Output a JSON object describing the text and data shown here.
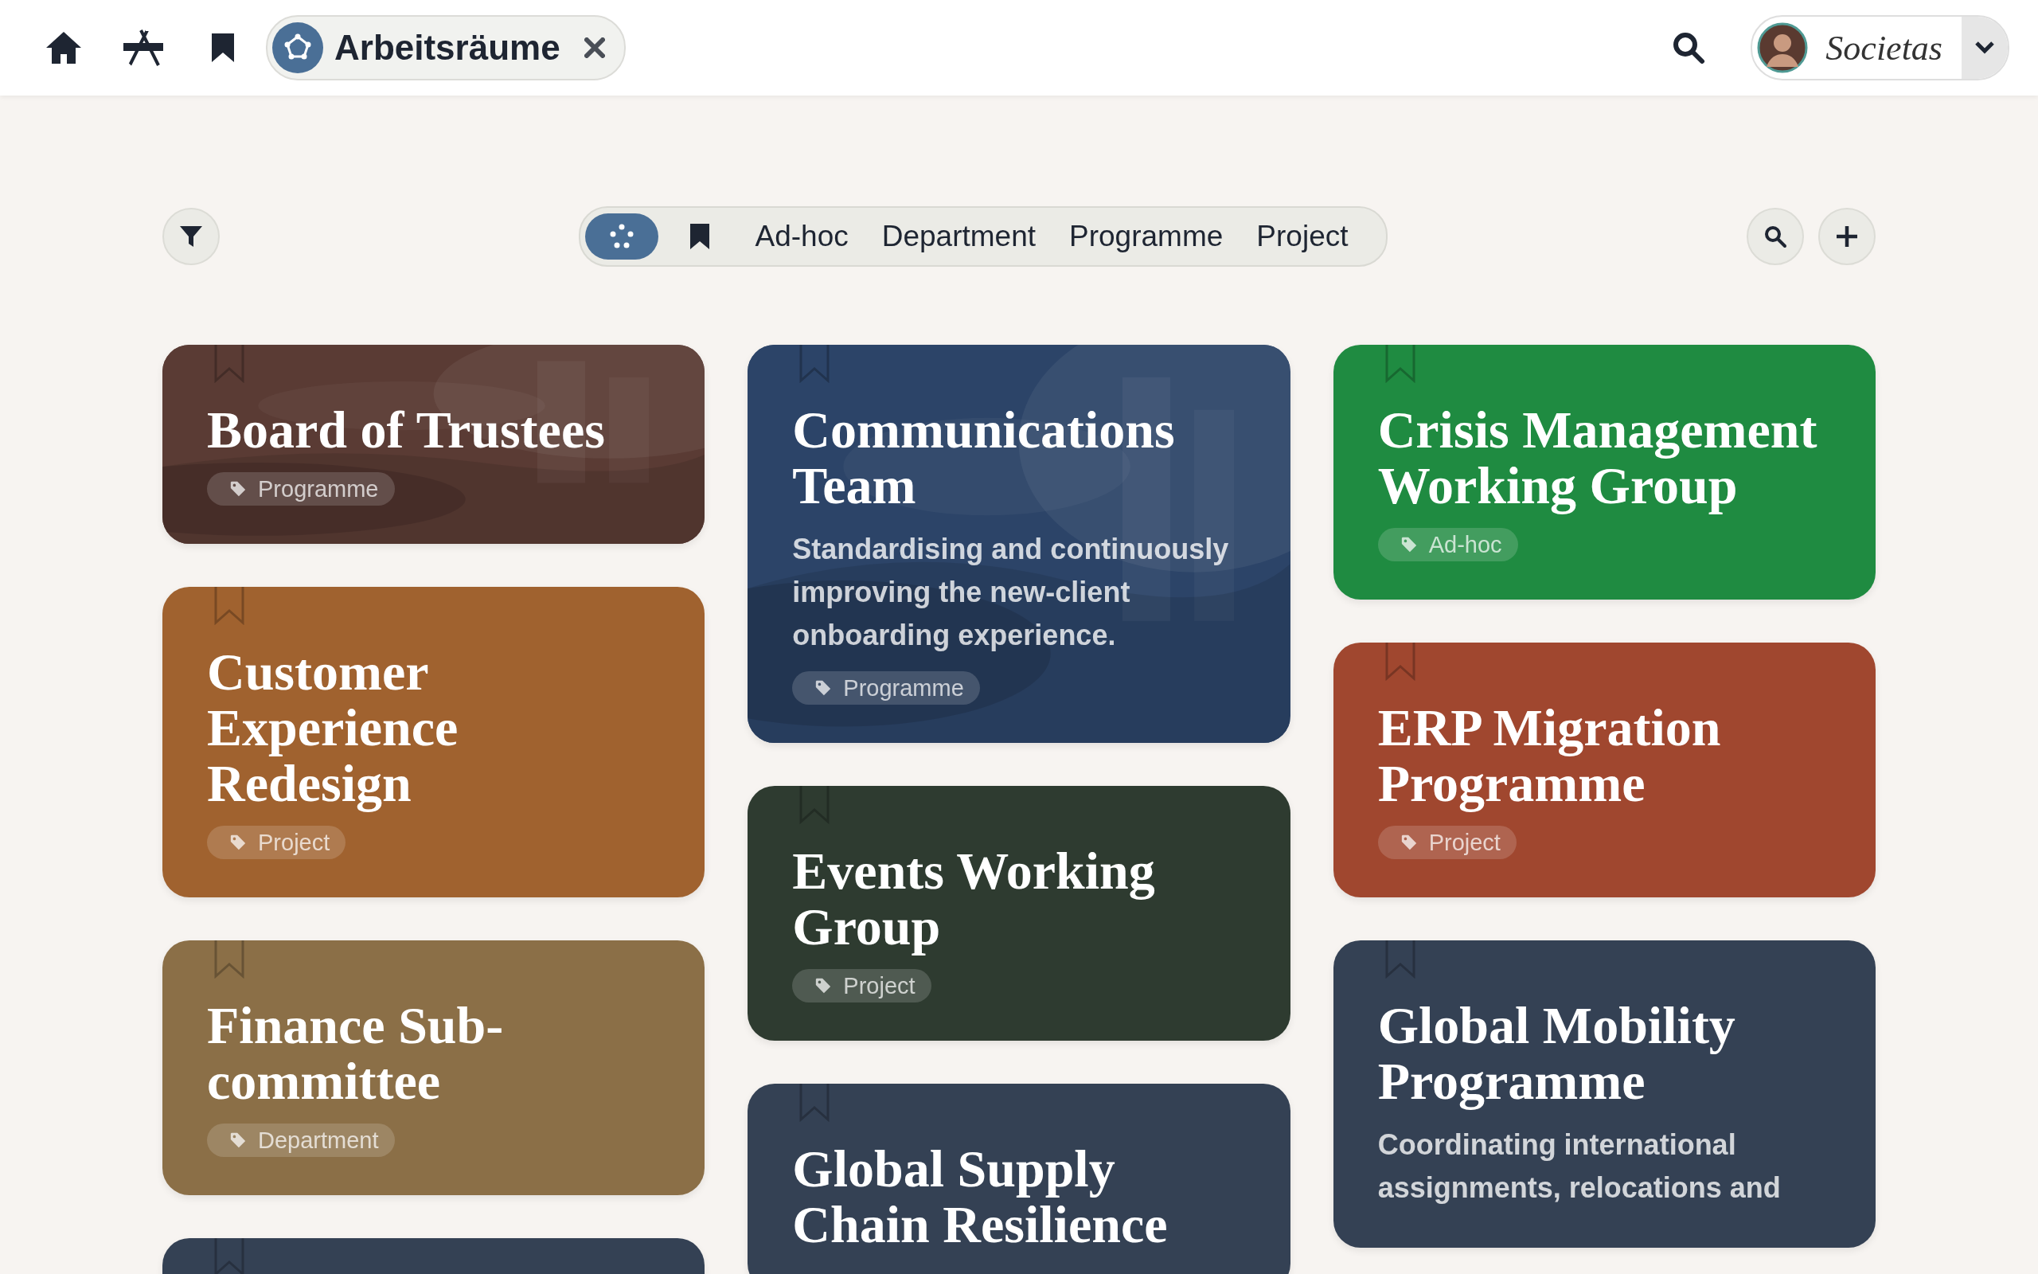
{
  "header": {
    "workspace_chip": {
      "label": "Arbeitsräume"
    },
    "user_menu": {
      "brand": "Societas"
    }
  },
  "filter_bar": {
    "segments": [
      {
        "kind": "all",
        "selected": true
      },
      {
        "kind": "bookmarks",
        "selected": false
      },
      {
        "kind": "text",
        "label": "Ad-hoc",
        "selected": false
      },
      {
        "kind": "text",
        "label": "Department",
        "selected": false
      },
      {
        "kind": "text",
        "label": "Programme",
        "selected": false
      },
      {
        "kind": "text",
        "label": "Project",
        "selected": false
      }
    ]
  },
  "columns": [
    [
      {
        "title": "Board of Trustees",
        "tag": "Programme",
        "color": "#5a3b34",
        "photo": true
      },
      {
        "title": "Customer Experience Redesign",
        "tag": "Project",
        "color": "#a0622f",
        "photo": false
      },
      {
        "title": "Finance Sub-committee",
        "tag": "Department",
        "color": "#8b6f47",
        "photo": false
      },
      {
        "color": "#344154",
        "photo": false
      }
    ],
    [
      {
        "title": "Communications Team",
        "description": "Standardising and continuously improving the new-client onboarding experience.",
        "tag": "Programme",
        "color": "#2c4468",
        "photo": true
      },
      {
        "title": "Events Working Group",
        "tag": "Project",
        "color": "#2e3b30",
        "photo": false
      },
      {
        "title": "Global Supply Chain Resilience",
        "color": "#344154",
        "photo": false
      }
    ],
    [
      {
        "title": "Crisis Management Working Group",
        "tag": "Ad-hoc",
        "color": "#1f8b41",
        "photo": false
      },
      {
        "title": "ERP Migration Programme",
        "tag": "Project",
        "color": "#a0472f",
        "photo": false
      },
      {
        "title": "Global Mobility Programme",
        "description": "Coordinating international assignments, relocations and",
        "color": "#344154",
        "photo": false
      }
    ]
  ]
}
